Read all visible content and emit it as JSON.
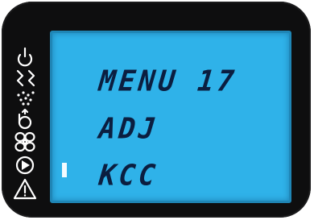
{
  "lcd": {
    "lines": [
      "MENU 17",
      "ADJ",
      "KCC"
    ],
    "selected_line": 3,
    "background_color": "#2fb2e9",
    "text_color": "#0b1e40"
  },
  "side_icons": [
    "power-icon",
    "zigzag-icon",
    "spray-icon",
    "meter-icon",
    "fan-icon",
    "play-icon",
    "warning-icon"
  ]
}
